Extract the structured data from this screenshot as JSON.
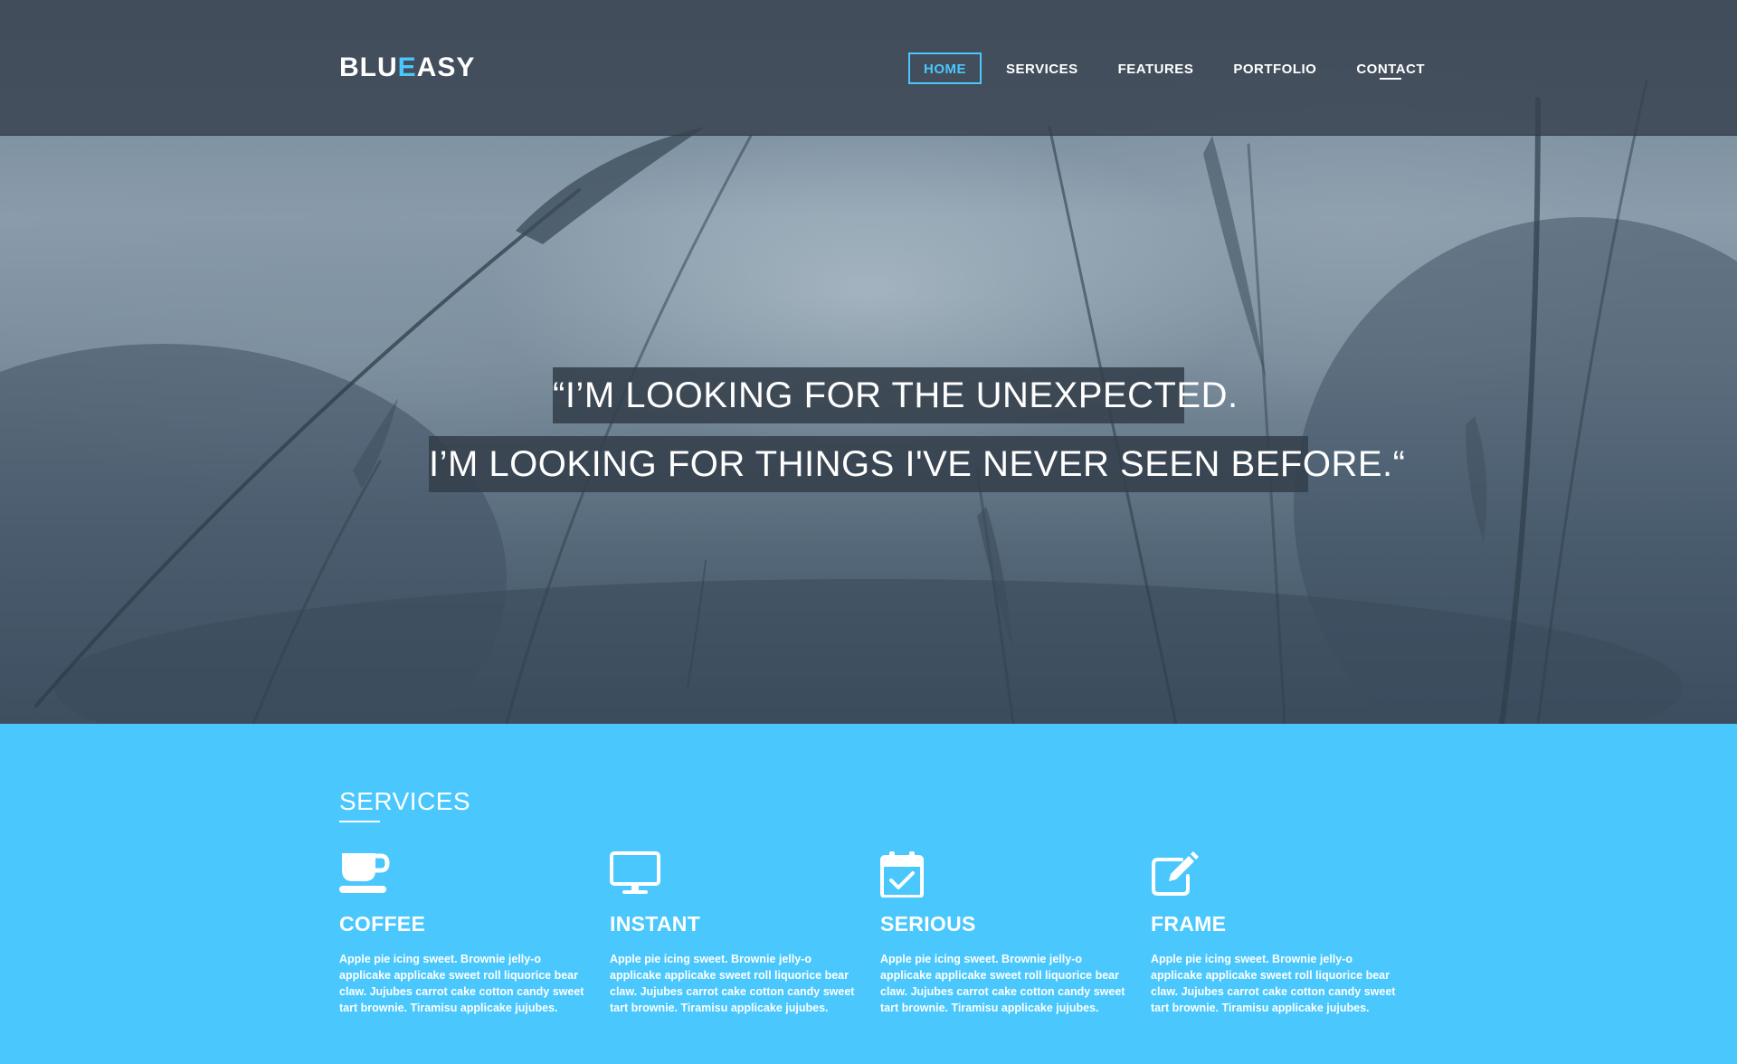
{
  "brand": {
    "logo_part1": "BLU",
    "logo_accent": "E",
    "logo_part2": "ASY",
    "accent_color": "#4ac7fd"
  },
  "nav": {
    "items": [
      {
        "label": "HOME",
        "active": true
      },
      {
        "label": "SERVICES"
      },
      {
        "label": "FEATURES"
      },
      {
        "label": "PORTFOLIO"
      },
      {
        "label": "CONTACT"
      }
    ]
  },
  "hero": {
    "quote_line_1": "“I’M LOOKING FOR THE UNEXPECTED.",
    "quote_line_2": "I’M LOOKING FOR THINGS I'VE NEVER SEEN BEFORE.“"
  },
  "services": {
    "title": "SERVICES",
    "background_color": "#4ac7fd",
    "items": [
      {
        "icon": "coffee-cup-icon",
        "title": "COFFEE",
        "text": "Apple pie icing sweet. Brownie jelly-o applicake applicake sweet roll liquorice bear claw. Jujubes carrot cake cotton candy sweet tart brownie. Tiramisu applicake jujubes."
      },
      {
        "icon": "monitor-icon",
        "title": "INSTANT",
        "text": "Apple pie icing sweet. Brownie jelly-o applicake applicake sweet roll liquorice bear claw. Jujubes carrot cake cotton candy sweet tart brownie. Tiramisu applicake jujubes."
      },
      {
        "icon": "calendar-check-icon",
        "title": "SERIOUS",
        "text": "Apple pie icing sweet. Brownie jelly-o applicake applicake sweet roll liquorice bear claw. Jujubes carrot cake cotton candy sweet tart brownie. Tiramisu applicake jujubes."
      },
      {
        "icon": "edit-icon",
        "title": "FRAME",
        "text": "Apple pie icing sweet. Brownie jelly-o applicake applicake sweet roll liquorice bear claw. Jujubes carrot cake cotton candy sweet tart brownie. Tiramisu applicake jujubes."
      }
    ]
  }
}
